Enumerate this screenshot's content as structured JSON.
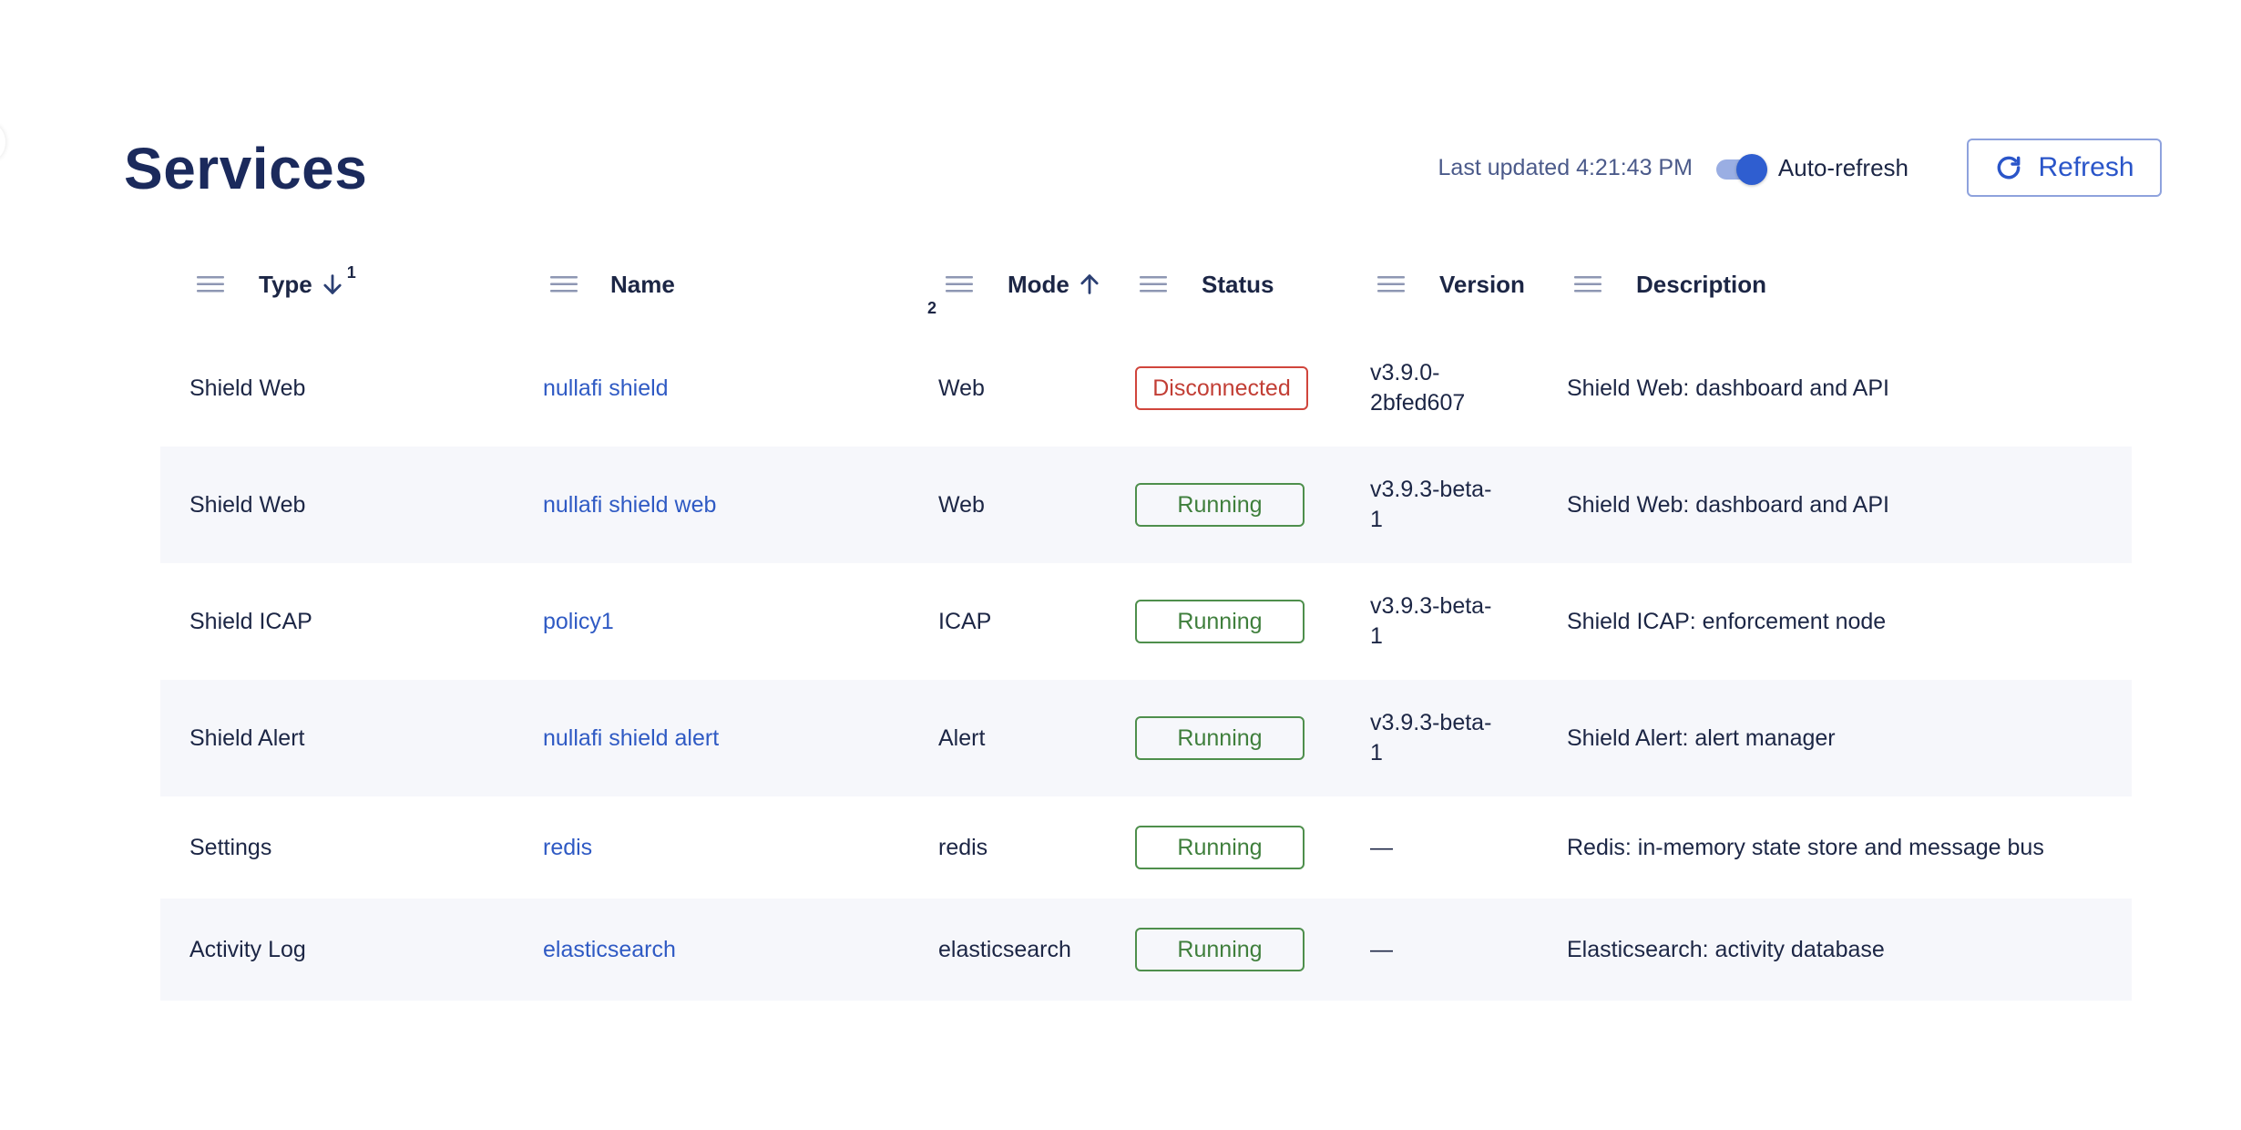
{
  "page": {
    "title": "Services"
  },
  "toolbar": {
    "last_updated_label": "Last updated",
    "last_updated_time": "4:21:43 PM",
    "auto_refresh_label": "Auto-refresh",
    "auto_refresh_on": true,
    "refresh_label": "Refresh"
  },
  "colors": {
    "title": "#1b2a5c",
    "accent": "#2f5ed0",
    "running": "#3f7f3c",
    "disconnected": "#c23e35",
    "zebra": "#f6f7fb"
  },
  "table": {
    "columns": [
      {
        "label": "Type",
        "sort": "descending",
        "sort_order": "1"
      },
      {
        "label": "Name"
      },
      {
        "label": "Mode",
        "sort": "ascending",
        "sort_order": "2"
      },
      {
        "label": "Status"
      },
      {
        "label": "Version"
      },
      {
        "label": "Description"
      }
    ],
    "rows": [
      {
        "type": "Shield Web",
        "name": "nullafi shield",
        "mode": "Web",
        "status": "Disconnected",
        "status_kind": "disconnected",
        "version_line1": "v3.9.0-",
        "version_line2": "2bfed607",
        "description": "Shield Web: dashboard and API"
      },
      {
        "type": "Shield Web",
        "name": "nullafi shield web",
        "mode": "Web",
        "status": "Running",
        "status_kind": "running",
        "version_line1": "v3.9.3-beta-",
        "version_line2": "1",
        "description": "Shield Web: dashboard and API"
      },
      {
        "type": "Shield ICAP",
        "name": "policy1",
        "mode": "ICAP",
        "status": "Running",
        "status_kind": "running",
        "version_line1": "v3.9.3-beta-",
        "version_line2": "1",
        "description": "Shield ICAP: enforcement node"
      },
      {
        "type": "Shield Alert",
        "name": "nullafi shield alert",
        "mode": "Alert",
        "status": "Running",
        "status_kind": "running",
        "version_line1": "v3.9.3-beta-",
        "version_line2": "1",
        "description": "Shield Alert: alert manager"
      },
      {
        "type": "Settings",
        "name": "redis",
        "mode": "redis",
        "status": "Running",
        "status_kind": "running",
        "version_line1": "—",
        "version_line2": "",
        "description": "Redis: in-memory state store and message bus"
      },
      {
        "type": "Activity Log",
        "name": "elasticsearch",
        "mode": "elasticsearch",
        "status": "Running",
        "status_kind": "running",
        "version_line1": "—",
        "version_line2": "",
        "description": "Elasticsearch: activity database"
      }
    ]
  }
}
